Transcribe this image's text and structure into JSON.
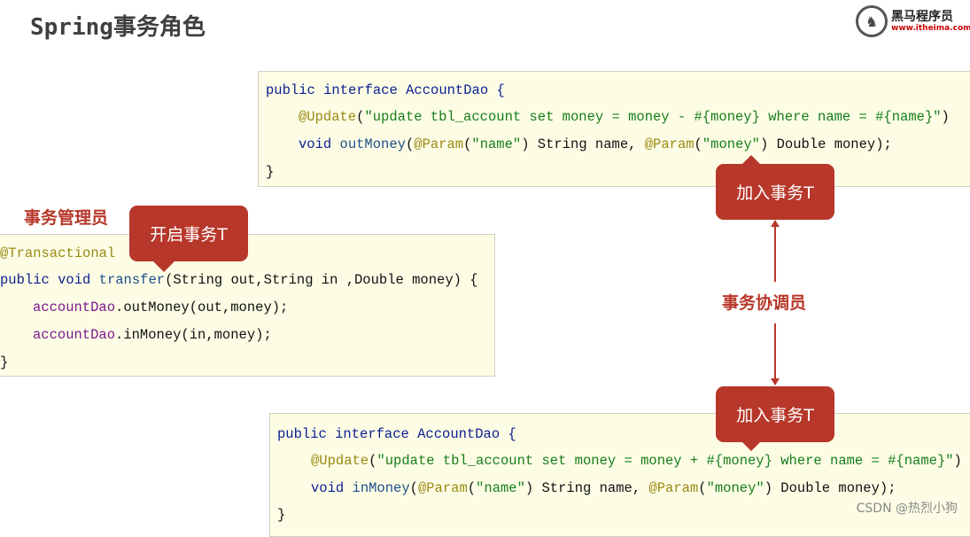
{
  "title": "Spring事务角色",
  "logo": {
    "name": "黑马程序员",
    "url": "www.itheima.com"
  },
  "roles": {
    "manager": "事务管理员",
    "coordinator": "事务协调员"
  },
  "bubbles": {
    "start": "开启事务T",
    "join_top": "加入事务T",
    "join_bottom": "加入事务T"
  },
  "code_top": [
    "public interface AccountDao {",
    "@Update(\"update tbl_account set money = money - #{money} where name = #{name}\")",
    "void outMoney(@Param(\"name\") String name, @Param(\"money\") Double money);",
    "}"
  ],
  "code_mid": [
    "@Transactional",
    "public void transfer(String out,String in ,Double money) {",
    "accountDao.outMoney(out,money);",
    "accountDao.inMoney(in,money);",
    "}"
  ],
  "code_bottom": [
    "public interface AccountDao {",
    "@Update(\"update tbl_account set money = money + #{money} where name = #{name}\")",
    "void inMoney(@Param(\"name\") String name, @Param(\"money\") Double money);",
    "}"
  ],
  "watermark": "CSDN @热烈小狗",
  "colors": {
    "accent": "#b7372a",
    "code_bg": "#fdfde6"
  }
}
